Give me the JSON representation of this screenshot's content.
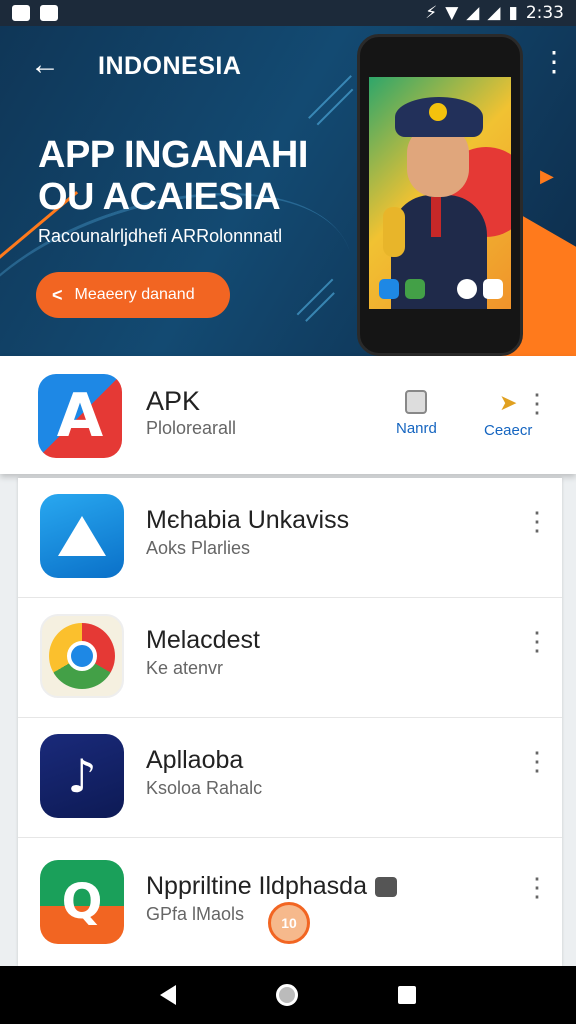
{
  "status_bar": {
    "time": "2:33"
  },
  "hero": {
    "title": "INDONESIA",
    "headline_line1": "APP INGANAHI",
    "headline_line2": "OU ACAIESIA",
    "subtitle": "Racounalrljdhefi ARRolonnnatl",
    "cta_label": "Meaeery danand"
  },
  "featured_app": {
    "name": "APK",
    "subtitle": "Plolorearall",
    "action1_label": "Nanrd",
    "action2_label": "Ceaecr"
  },
  "apps": [
    {
      "name": "Mєhabia Unkaviss",
      "subtitle": "Aoks Plarlies",
      "icon": "a-logo-icon"
    },
    {
      "name": "Melacdest",
      "subtitle": "Ke atenvr",
      "icon": "chrome-icon"
    },
    {
      "name": "Apllaoba",
      "subtitle": "Ksoloa Rahalc",
      "icon": "music-note-icon"
    },
    {
      "name": "Nppriltine Ildphasda",
      "subtitle": "GPfa lMaols",
      "icon": "q-logo-icon"
    }
  ],
  "floating_badge": "10",
  "colors": {
    "accent": "#f26522",
    "hero_bg": "#134a72",
    "link": "#1565c0"
  }
}
